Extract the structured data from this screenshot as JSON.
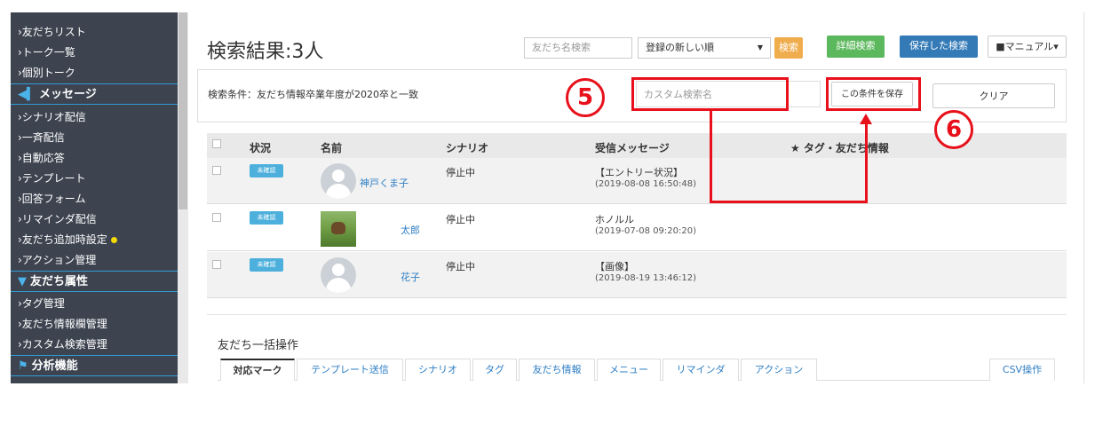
{
  "sidebar": {
    "items_top": [
      "›友だちリスト",
      "›トーク一覧",
      "›個別トーク"
    ],
    "section_message": "メッセージ",
    "items_message": [
      "›シナリオ配信",
      "›一斉配信",
      "›自動応答",
      "›テンプレート",
      "›回答フォーム",
      "›リマインダ配信",
      "›友だち追加時設定",
      "›アクション管理"
    ],
    "section_attr": "友だち属性",
    "items_attr": [
      "›タグ管理",
      "›友だち情報欄管理",
      "›カスタム検索管理"
    ],
    "section_analysis": "分析機能"
  },
  "header": {
    "title": "検索結果:3人",
    "search_placeholder": "友だち名検索",
    "sort_value": "登録の新しい順",
    "search_button": "検索",
    "detail_button": "詳細検索",
    "saved_button": "保存した検索",
    "manual_button": "マニュアル▾"
  },
  "condition": {
    "text": "検索条件：友だち情報卒業年度が2020卒と一致",
    "custom_name_placeholder": "カスタム検索名",
    "save_button": "この条件を保存",
    "clear_button": "クリア"
  },
  "table": {
    "headers": [
      "状況",
      "名前",
      "シナリオ",
      "受信メッセージ",
      "★ タグ・友だち情報"
    ],
    "rows": [
      {
        "status": "未確認",
        "name": "神戸くま子",
        "scenario": "停止中",
        "message": "【エントリー状況】",
        "time": "(2019-08-08 16:50:48)"
      },
      {
        "status": "未確認",
        "name": "太郎",
        "scenario": "停止中",
        "message": "ホノルル",
        "time": "(2019-07-08 09:20:20)"
      },
      {
        "status": "未確認",
        "name": "花子",
        "scenario": "停止中",
        "message": "【画像】",
        "time": "(2019-08-19 13:46:12)"
      }
    ]
  },
  "bulk": {
    "title": "友だち一括操作",
    "tabs": [
      "対応マーク",
      "テンプレート送信",
      "シナリオ",
      "タグ",
      "友だち情報",
      "メニュー",
      "リマインダ",
      "アクション"
    ],
    "csv_tab": "CSV操作"
  },
  "annotations": {
    "five": "5",
    "six": "6"
  },
  "colors": {
    "accent": "#e8101a",
    "sidebar": "#3d4450",
    "badge": "#4db0dc",
    "search": "#f0ad4e",
    "detail": "#5cb85c",
    "saved": "#337ab7"
  }
}
